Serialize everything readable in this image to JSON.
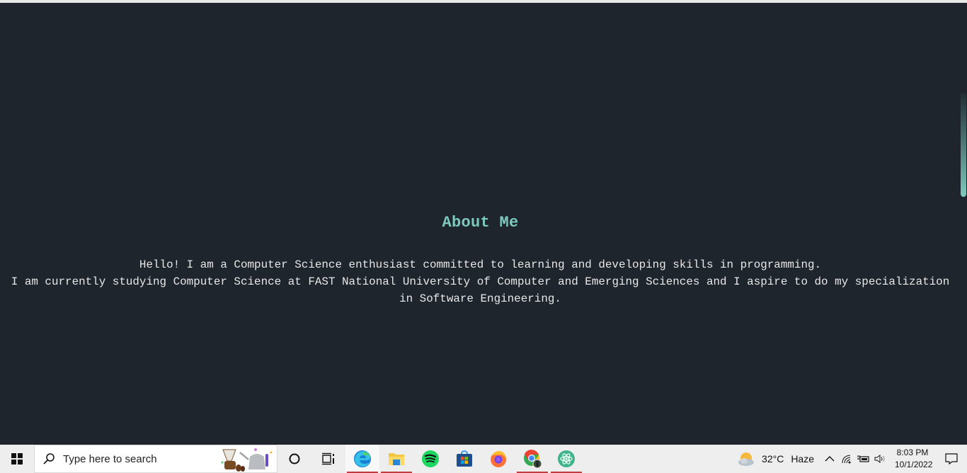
{
  "page": {
    "heading": "About Me",
    "bio_lines": [
      "Hello! I am a Computer Science enthusiast committed to learning and developing skills in programming.",
      "I am currently studying Computer Science at FAST National University of Computer and Emerging Sciences and I aspire to do my specialization in Software Engineering."
    ],
    "colors": {
      "background": "#1e252d",
      "heading": "#7ec9bf",
      "text": "#e8e8e8"
    }
  },
  "taskbar": {
    "search_placeholder": "Type here to search",
    "apps": [
      {
        "name": "cortana",
        "icon": "circle-icon"
      },
      {
        "name": "task-view",
        "icon": "task-view-icon"
      },
      {
        "name": "microsoft-edge",
        "icon": "edge-icon",
        "running": true,
        "active": true
      },
      {
        "name": "file-explorer",
        "icon": "folder-icon",
        "running": true
      },
      {
        "name": "spotify",
        "icon": "spotify-icon"
      },
      {
        "name": "microsoft-store",
        "icon": "store-icon"
      },
      {
        "name": "firefox",
        "icon": "firefox-icon"
      },
      {
        "name": "google-chrome",
        "icon": "chrome-icon",
        "running": true
      },
      {
        "name": "atom",
        "icon": "atom-icon",
        "running": true
      }
    ],
    "weather": {
      "temp": "32°C",
      "condition": "Haze"
    },
    "clock": {
      "time": "8:03 PM",
      "date": "10/1/2022"
    }
  }
}
